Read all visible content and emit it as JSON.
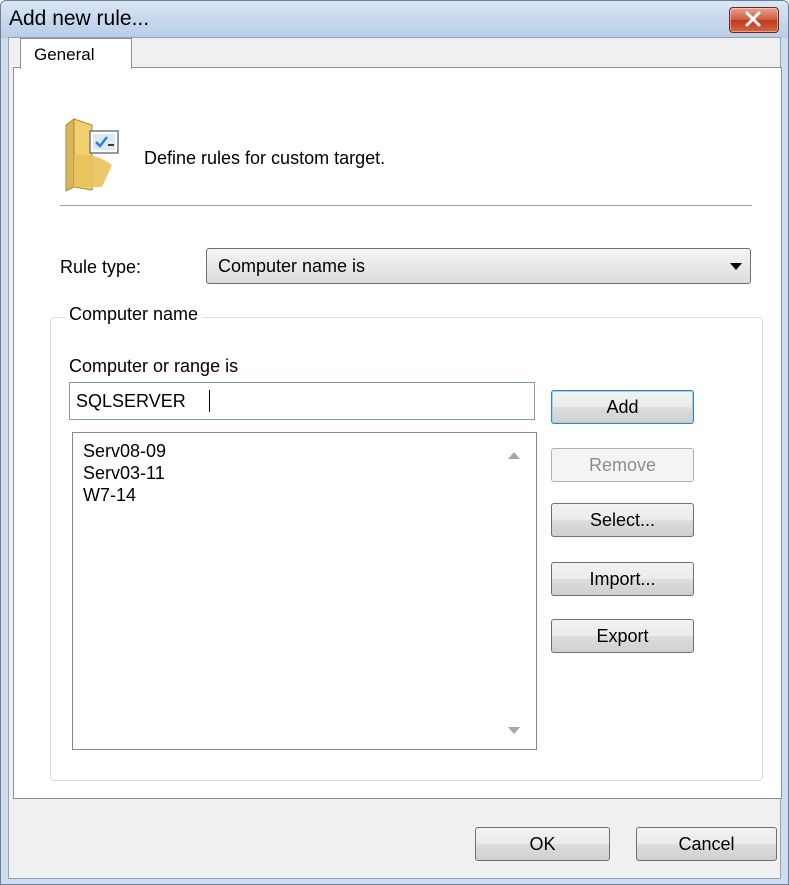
{
  "window": {
    "title": "Add new rule..."
  },
  "tabs": [
    {
      "label": "General"
    }
  ],
  "intro": {
    "text": "Define rules for custom target."
  },
  "rule_type": {
    "label": "Rule type:",
    "selected": "Computer name is"
  },
  "group": {
    "legend": "Computer name",
    "field_label": "Computer or range is",
    "input_value": "SQLSERVER",
    "list_items": [
      "Serv08-09",
      "Serv03-11",
      "W7-14"
    ]
  },
  "buttons": {
    "add": "Add",
    "remove": "Remove",
    "select": "Select...",
    "import": "Import...",
    "export": "Export",
    "ok": "OK",
    "cancel": "Cancel"
  },
  "colors": {
    "close_button": "#c9442a",
    "chrome": "#cfdeef",
    "accent_border": "#3c7fb1"
  }
}
